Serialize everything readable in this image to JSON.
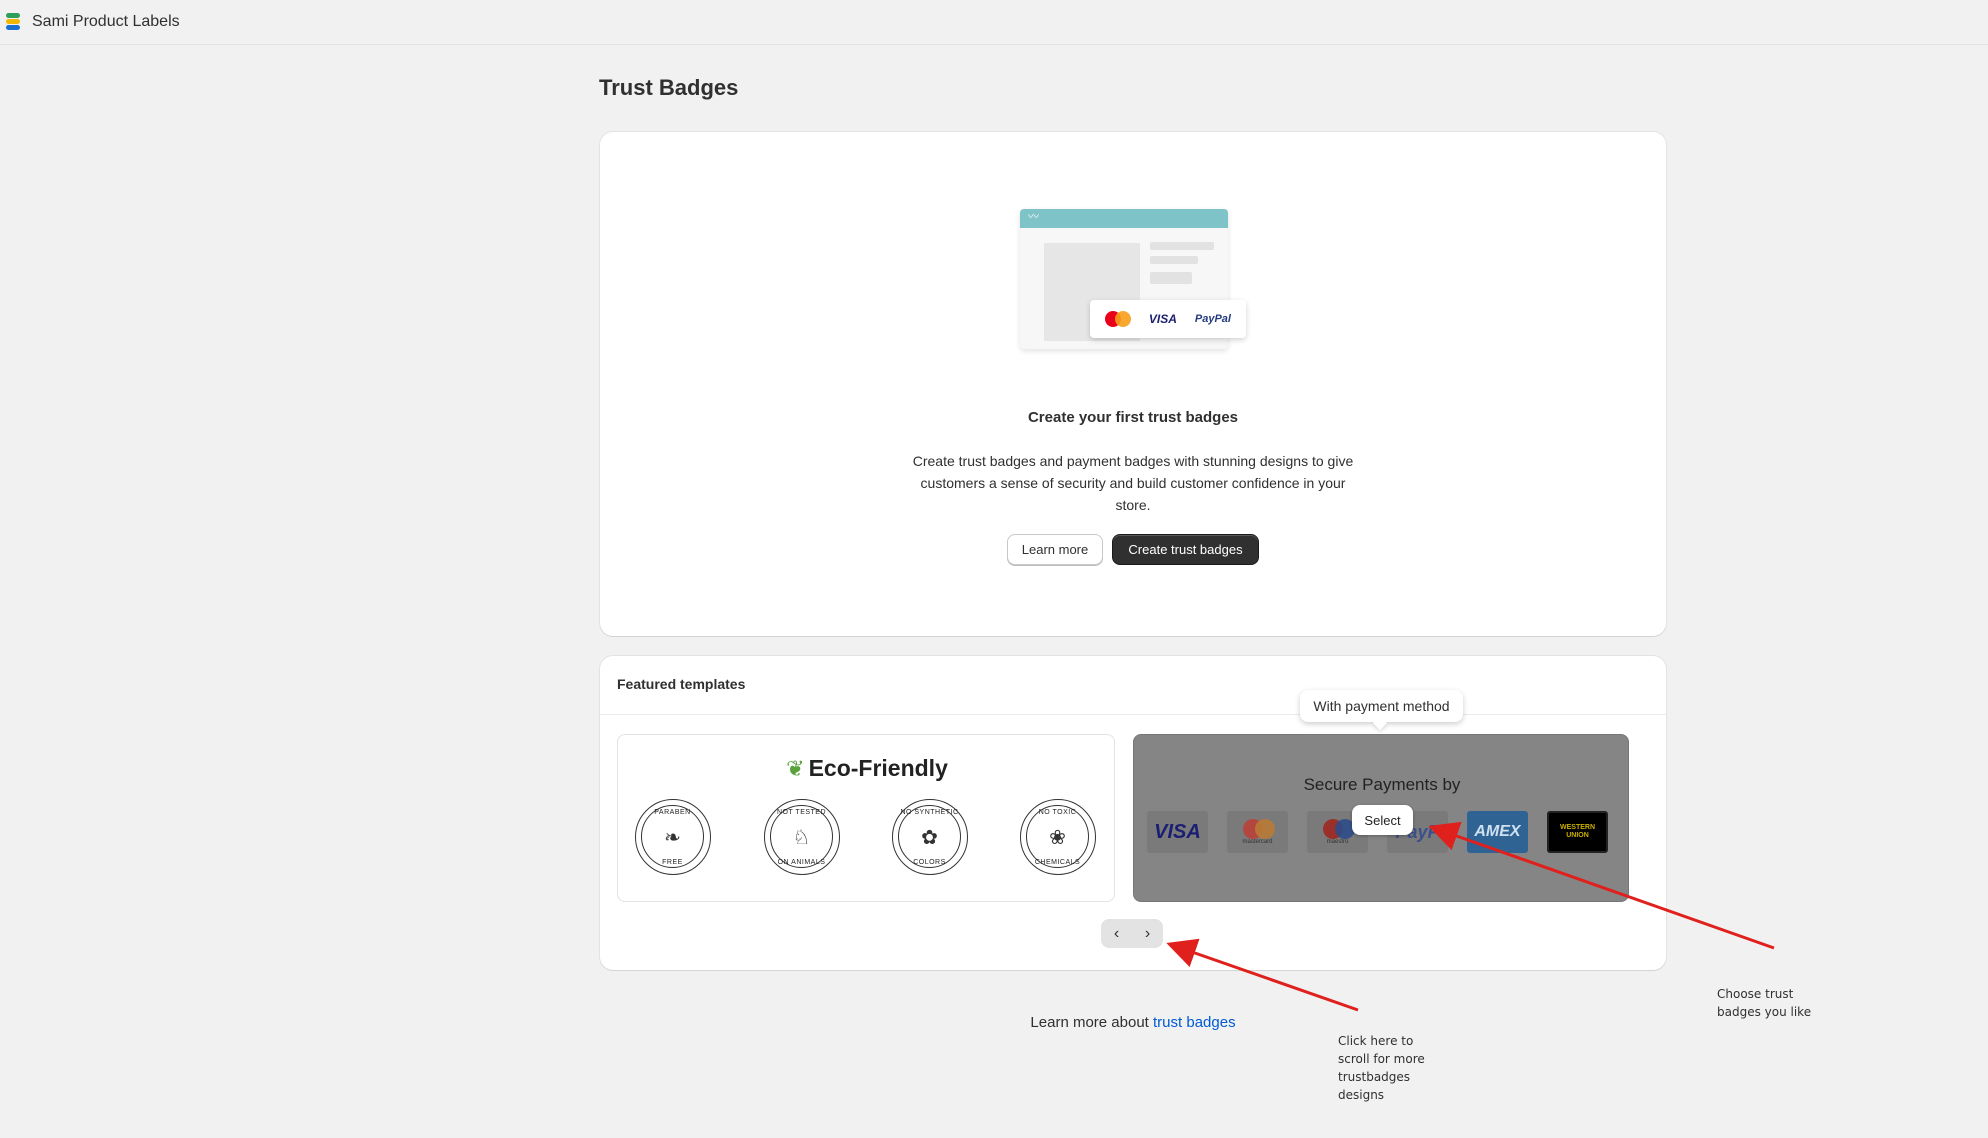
{
  "app": {
    "title": "Sami Product Labels",
    "logo_colors": [
      "#2e9e5b",
      "#f2b705",
      "#1b6fd1"
    ]
  },
  "page": {
    "title": "Trust Badges"
  },
  "empty_state": {
    "illustration": {
      "payment_logos": [
        "VISA",
        "PayPal"
      ]
    },
    "heading": "Create your first trust badges",
    "description": "Create trust badges and payment badges with stunning designs to give customers a sense of security and build customer confidence in your store.",
    "secondary_action": "Learn more",
    "primary_action": "Create trust badges"
  },
  "featured": {
    "heading": "Featured templates",
    "eco_template": {
      "title": "Eco-Friendly",
      "badges": [
        {
          "top": "PARABEN",
          "bottom": "FREE",
          "icon": "leaf-icon"
        },
        {
          "top": "NOT TESTED",
          "bottom": "ON ANIMALS",
          "icon": "rabbit-icon"
        },
        {
          "top": "NO SYNTHETIC",
          "bottom": "COLORS",
          "icon": "flower-icon"
        },
        {
          "top": "NO TOXIC",
          "bottom": "CHEMICALS",
          "icon": "leaf-circle-icon"
        }
      ]
    },
    "payment_template": {
      "tooltip": "With payment method",
      "title": "Secure Payments by",
      "select_label": "Select",
      "logos": [
        {
          "name": "VISA",
          "bg": "#e9e9e9",
          "fg": "#1a1f71"
        },
        {
          "name": "mastercard",
          "bg": "#e9e9e9",
          "fg": "#333333"
        },
        {
          "name": "maestro",
          "bg": "#e9e9e9",
          "fg": "#333333"
        },
        {
          "name": "PayP",
          "bg": "#e9e9e9",
          "fg": "#253b80"
        },
        {
          "name": "AMEX",
          "bg": "#2e77bc",
          "fg": "#ffffff"
        },
        {
          "name": "WESTERN UNION",
          "bg": "#000000",
          "fg": "#ffdd00"
        }
      ]
    },
    "pager": {
      "prev": "‹",
      "next": "›"
    }
  },
  "footer": {
    "prefix": "Learn more about",
    "link": "trust badges"
  },
  "annotations": {
    "scroll_hint": [
      "Click here to",
      "scroll for more",
      "trustbadges",
      "designs"
    ],
    "choose_hint": [
      "Choose trust",
      "badges you like"
    ],
    "arrow_color": "#e0201c"
  }
}
